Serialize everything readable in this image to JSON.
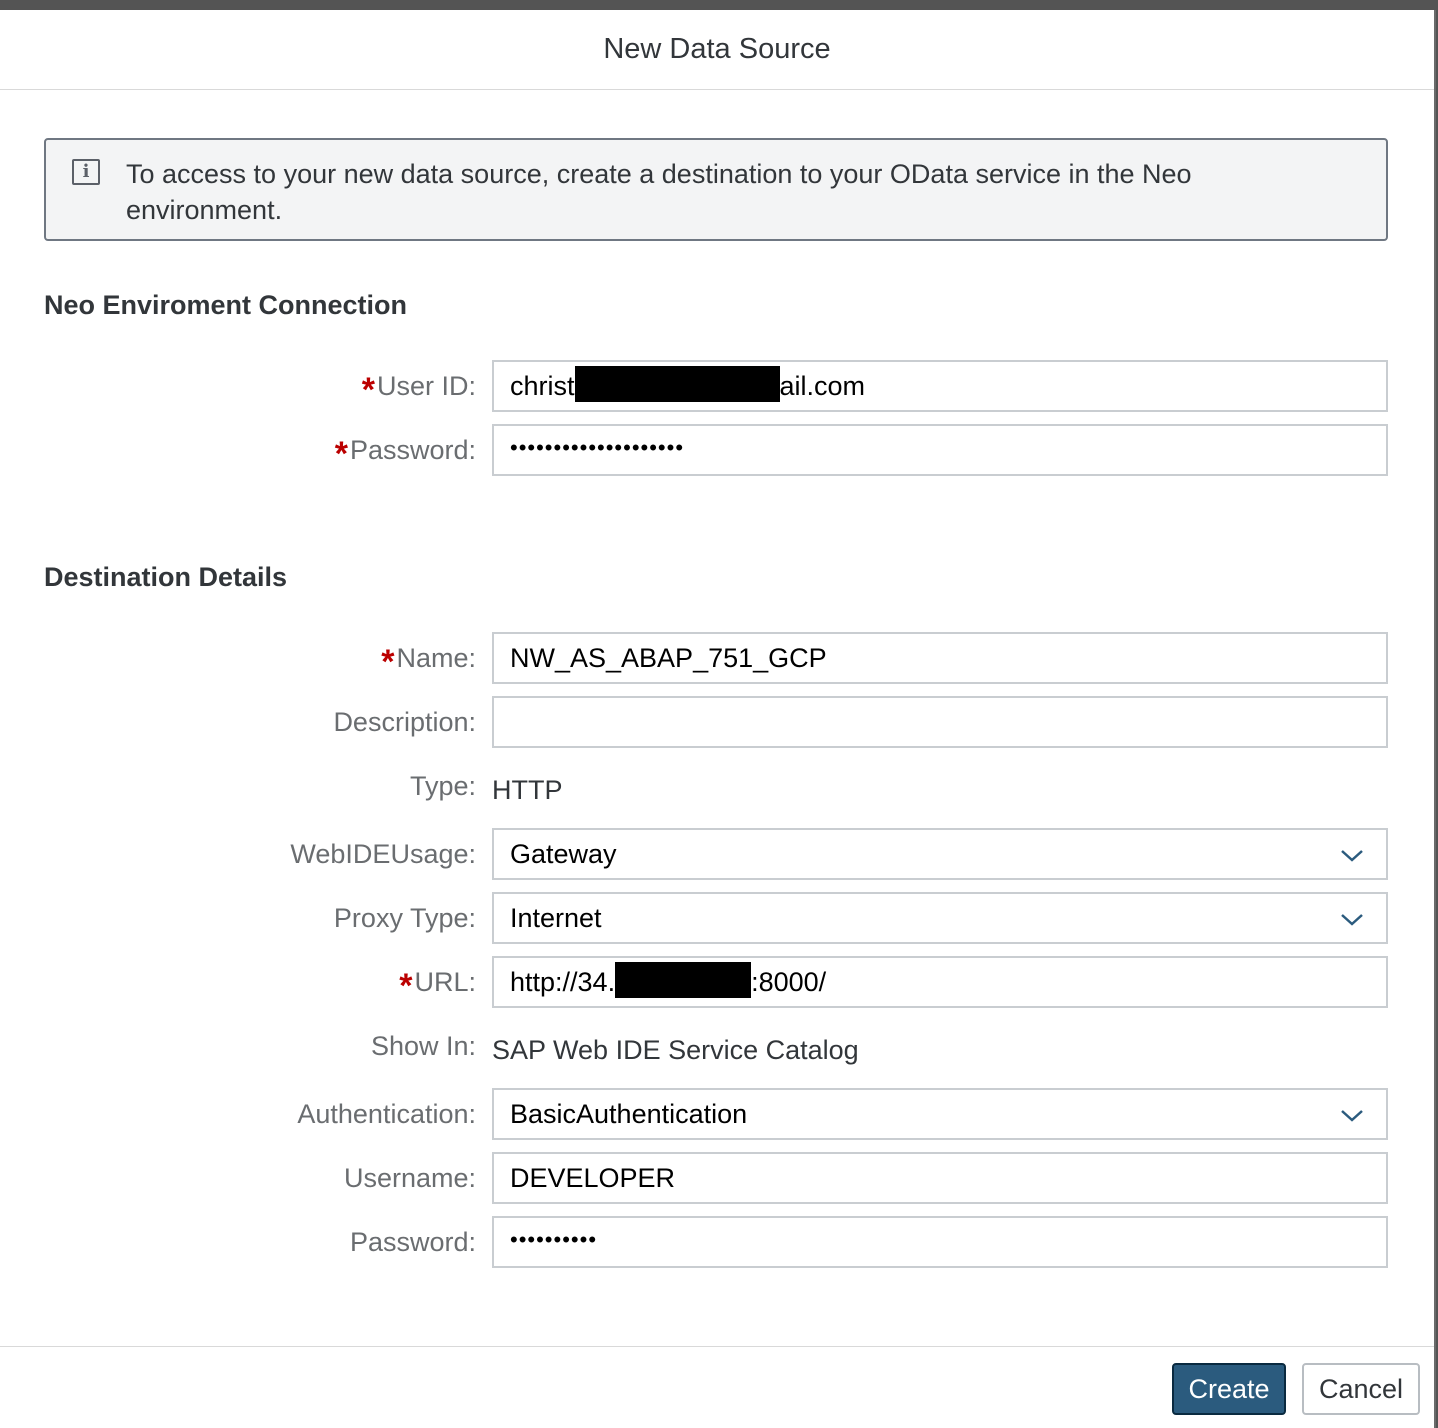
{
  "dialog": {
    "title": "New Data Source"
  },
  "info": {
    "icon": "info-icon",
    "message": "To access to your new data source, create a destination to your OData service in the Neo environment."
  },
  "neo_section": {
    "title": "Neo Enviroment Connection",
    "user_id": {
      "label": "User ID:",
      "required": true,
      "value_prefix": "christ",
      "value_suffix": "ail.com"
    },
    "password": {
      "label": "Password:",
      "required": true,
      "value": "••••••••••••••••••••"
    }
  },
  "destination_section": {
    "title": "Destination Details",
    "name": {
      "label": "Name:",
      "required": true,
      "value": "NW_AS_ABAP_751_GCP"
    },
    "description": {
      "label": "Description:",
      "value": ""
    },
    "type": {
      "label": "Type:",
      "value": "HTTP"
    },
    "webide_usage": {
      "label": "WebIDEUsage:",
      "value": "Gateway"
    },
    "proxy_type": {
      "label": "Proxy Type:",
      "value": "Internet"
    },
    "url": {
      "label": "URL:",
      "required": true,
      "value_prefix": "http://34.",
      "value_suffix": ":8000/"
    },
    "show_in": {
      "label": "Show In:",
      "value": "SAP Web IDE Service Catalog"
    },
    "authentication": {
      "label": "Authentication:",
      "value": "BasicAuthentication"
    },
    "username": {
      "label": "Username:",
      "value": "DEVELOPER"
    },
    "password": {
      "label": "Password:",
      "value": "••••••••••"
    }
  },
  "footer": {
    "create_label": "Create",
    "cancel_label": "Cancel"
  },
  "colors": {
    "primary_button": "#2b5b7e",
    "required_marker": "#bb0000",
    "info_background": "#f3f4f5"
  }
}
